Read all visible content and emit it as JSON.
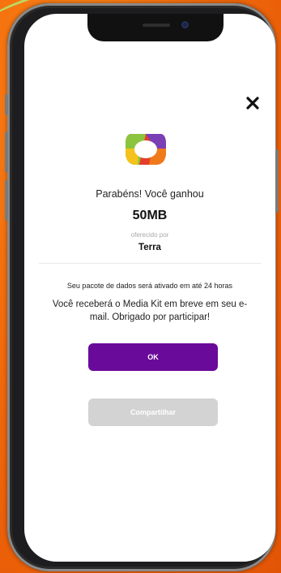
{
  "modal": {
    "close_icon": "close-icon",
    "logo_icon": "tv-logo-icon",
    "congrats_text": "Parabéns! Você ganhou",
    "prize_amount": "50MB",
    "offered_by_label": "oferecido por",
    "brand_name": "Terra",
    "activation_text": "Seu pacote de dados será ativado em até 24 horas",
    "message_text": "Você receberá o Media Kit em breve em seu e-mail. Obrigado por participar!",
    "ok_label": "OK",
    "share_label": "Compartilhar"
  },
  "colors": {
    "primary": "#6a0a9a",
    "disabled": "#d3d3d3",
    "background": "#f26b0c"
  }
}
